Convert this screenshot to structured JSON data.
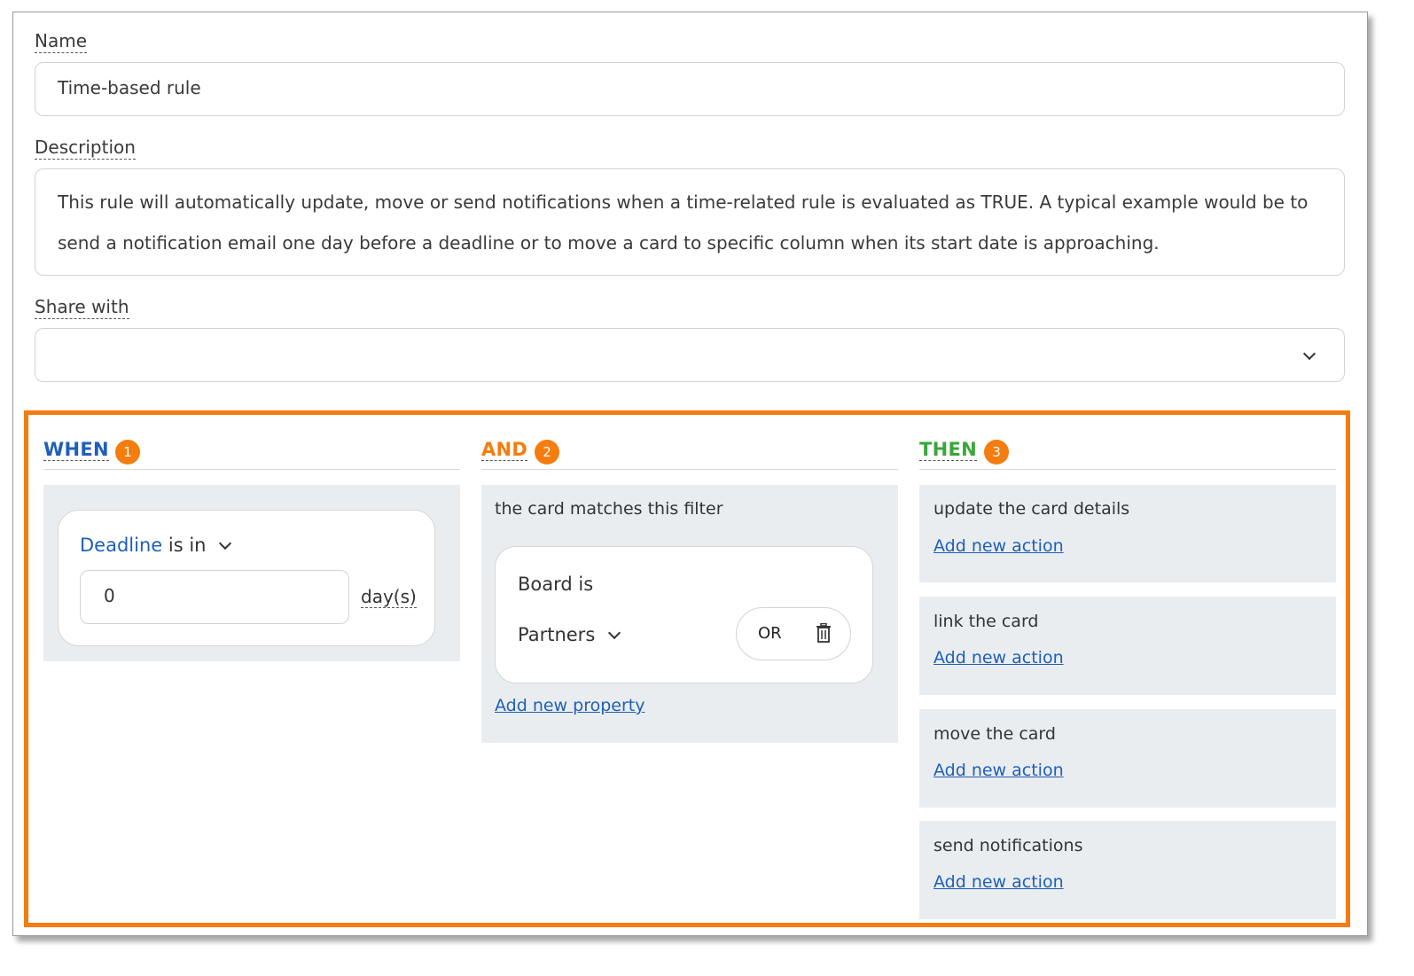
{
  "form": {
    "name_label": "Name",
    "name_value": "Time-based rule",
    "description_label": "Description",
    "description_value": "This rule will automatically update, move or send notifications when a time-related rule is evaluated as TRUE. A typical example would be to send a notification email one day before a deadline or to move a card to specific column when its start date is approaching.",
    "share_label": "Share with",
    "share_value": ""
  },
  "when": {
    "title": "WHEN",
    "step": "1",
    "field_link": "Deadline",
    "operator": "is in",
    "days_value": "0",
    "days_unit": "day(s)"
  },
  "and": {
    "title": "AND",
    "step": "2",
    "intro": "the card matches this filter",
    "property": "Board is",
    "value": "Partners",
    "or_label": "OR",
    "add_property": "Add new property"
  },
  "then": {
    "title": "THEN",
    "step": "3",
    "actions": [
      {
        "label": "update the card details",
        "add": "Add new action"
      },
      {
        "label": "link the card",
        "add": "Add new action"
      },
      {
        "label": "move the card",
        "add": "Add new action"
      },
      {
        "label": "send notifications",
        "add": "Add new action"
      }
    ]
  },
  "colors": {
    "when": "#1f5fb8",
    "and": "#f57c0e",
    "then": "#3aa63a",
    "highlight": "#f57c0e",
    "panel": "#eaedf0"
  }
}
